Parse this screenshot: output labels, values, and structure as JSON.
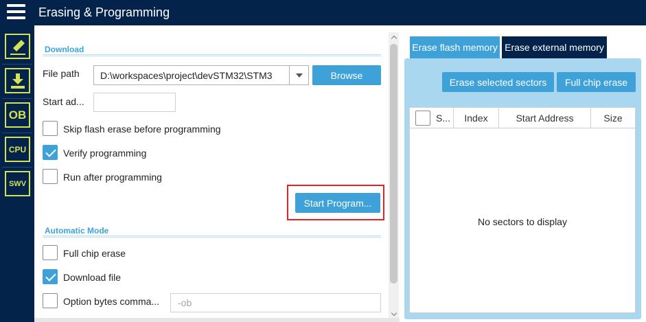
{
  "header": {
    "title": "Erasing & Programming"
  },
  "sidebar": {
    "items": [
      {
        "name": "erasing-programming",
        "icon": "edit-pencil-icon",
        "active": true
      },
      {
        "name": "download",
        "icon": "download-icon",
        "active": false
      },
      {
        "name": "option-bytes",
        "icon": "option-bytes-icon",
        "label": "OB",
        "active": false
      },
      {
        "name": "cpu",
        "icon": "cpu-icon",
        "label": "CPU",
        "active": false
      },
      {
        "name": "swv",
        "icon": "swv-icon",
        "label": "SWV",
        "active": false
      }
    ]
  },
  "download_section": {
    "title": "Download",
    "file_path_label": "File path",
    "file_path_value": "D:\\workspaces\\project\\devSTM32\\STM3",
    "browse_label": "Browse",
    "start_address_label": "Start ad...",
    "start_address_value": "",
    "options": [
      {
        "label": "Skip flash erase before programming",
        "checked": false
      },
      {
        "label": "Verify programming",
        "checked": true
      },
      {
        "label": "Run after programming",
        "checked": false
      }
    ],
    "start_button_label": "Start Program..."
  },
  "automatic_mode": {
    "title": "Automatic Mode",
    "options": [
      {
        "label": "Full chip erase",
        "checked": false
      },
      {
        "label": "Download file",
        "checked": true
      },
      {
        "label": "Option bytes comma...",
        "checked": false
      }
    ],
    "option_bytes_placeholder": "-ob"
  },
  "erase_panel": {
    "tabs": [
      {
        "label": "Erase flash memory",
        "active": true
      },
      {
        "label": "Erase external memory",
        "active": false
      }
    ],
    "erase_selected_label": "Erase selected sectors",
    "full_chip_erase_label": "Full chip erase",
    "table": {
      "columns": [
        "S...",
        "Index",
        "Start Address",
        "Size"
      ],
      "empty_message": "No sectors to display"
    }
  },
  "colors": {
    "navy": "#03234b",
    "accent": "#3ea2d9",
    "lime": "#d4e157",
    "highlight": "#e02424"
  }
}
